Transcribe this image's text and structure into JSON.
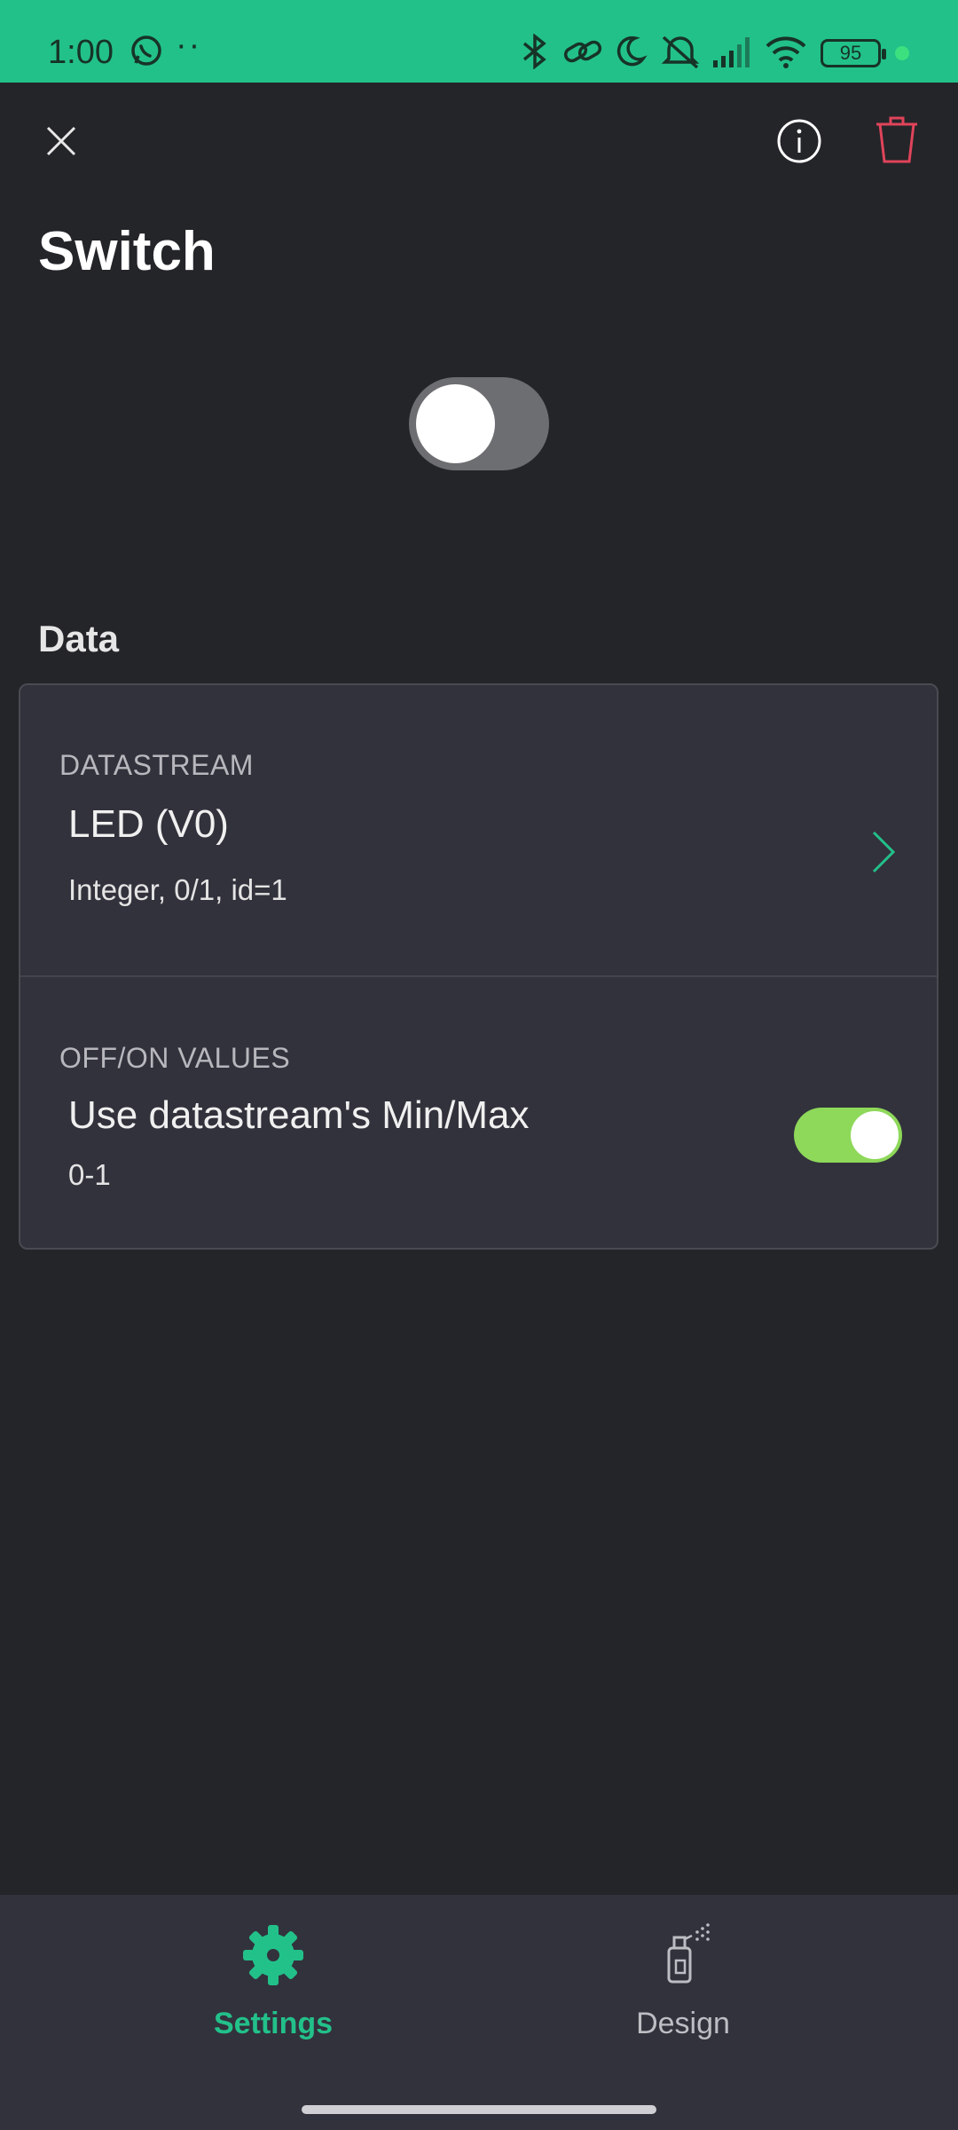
{
  "status_bar": {
    "time": "1:00",
    "battery": "95",
    "dots": "··",
    "colors": {
      "background": "#22c18a"
    }
  },
  "header": {
    "title": "Switch",
    "icons": [
      "close-icon",
      "info-icon",
      "trash-icon"
    ]
  },
  "preview": {
    "switch_state": "off"
  },
  "data_section": {
    "label": "Data",
    "datastream": {
      "caption": "DATASTREAM",
      "title": "LED (V0)",
      "subtitle": "Integer, 0/1, id=1"
    },
    "values": {
      "caption": "OFF/ON VALUES",
      "title": "Use datastream's Min/Max",
      "subtitle": "0-1",
      "toggle_state": "on"
    }
  },
  "bottom_nav": {
    "tabs": [
      {
        "label": "Settings",
        "icon": "gear-icon",
        "active": true
      },
      {
        "label": "Design",
        "icon": "spray-can-icon",
        "active": false
      }
    ]
  },
  "colors": {
    "accent": "#22c18a",
    "toggle_on": "#8ed85a",
    "danger": "#e0445a"
  }
}
